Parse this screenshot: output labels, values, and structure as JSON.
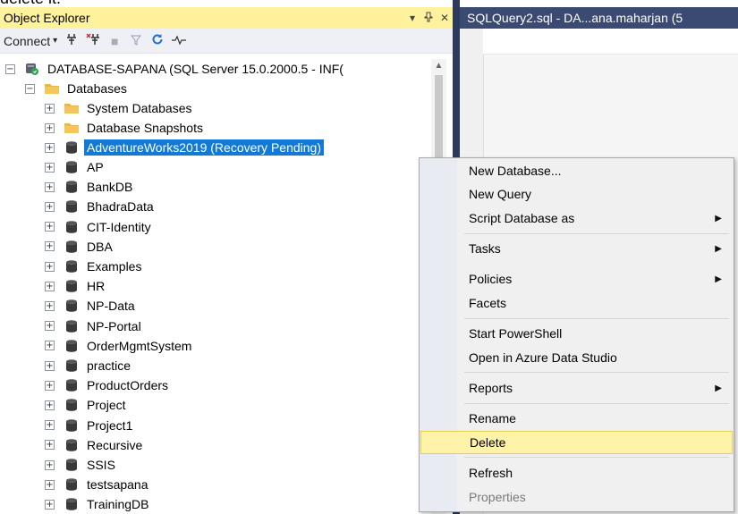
{
  "top_caption": "delete it.",
  "object_explorer": {
    "title": "Object Explorer",
    "controls": {
      "dropdown": "▾",
      "pin": "ᵖ",
      "close": "✕"
    },
    "toolbar": {
      "connect_label": "Connect",
      "connect_arrow": "▾"
    },
    "server_node": "DATABASE-SAPANA (SQL Server 15.0.2000.5 - INF(",
    "databases_node": "Databases",
    "folders": [
      "System Databases",
      "Database Snapshots"
    ],
    "selected_db": "AdventureWorks2019 (Recovery Pending)",
    "databases": [
      "AP",
      "BankDB",
      "BhadraData",
      "CIT-Identity",
      "DBA",
      "Examples",
      "HR",
      "NP-Data",
      "NP-Portal",
      "OrderMgmtSystem",
      "practice",
      "ProductOrders",
      "Project",
      "Project1",
      "Recursive",
      "SSIS",
      "testsapana",
      "TrainingDB"
    ]
  },
  "editor": {
    "tab_title": "SQLQuery2.sql - DA...ana.maharjan (5"
  },
  "context_menu": {
    "items": [
      {
        "label": "New Database...",
        "submenu": false
      },
      {
        "label": "New Query",
        "submenu": false
      },
      {
        "label": "Script Database as",
        "submenu": true
      },
      {
        "label": "Tasks",
        "submenu": true
      },
      {
        "label": "Policies",
        "submenu": true
      },
      {
        "label": "Facets",
        "submenu": false
      },
      {
        "label": "Start PowerShell",
        "submenu": false
      },
      {
        "label": "Open in Azure Data Studio",
        "submenu": false
      },
      {
        "label": "Reports",
        "submenu": true
      },
      {
        "label": "Rename",
        "submenu": false
      },
      {
        "label": "Delete",
        "submenu": false,
        "highlighted": true
      },
      {
        "label": "Refresh",
        "submenu": false
      },
      {
        "label": "Properties",
        "submenu": false,
        "disabled": true
      }
    ],
    "arrow_glyph": "▶"
  },
  "colors": {
    "title_bar": "#fff29d",
    "selection": "#1279d6",
    "menu_highlight": "#fef3a8",
    "editor_tab": "#3b4a73",
    "folder": "#e8b94a",
    "db_icon": "#3a3a3a"
  }
}
